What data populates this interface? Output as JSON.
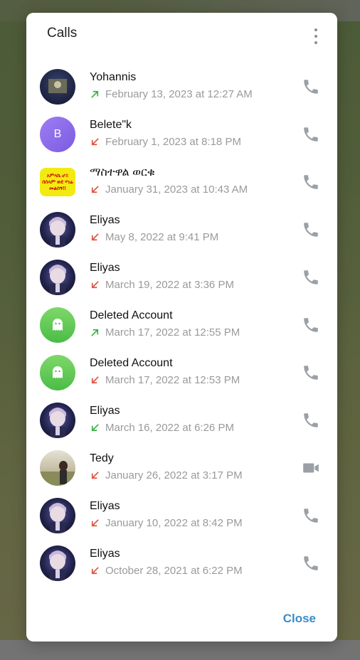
{
  "dialog": {
    "title": "Calls",
    "close_label": "Close"
  },
  "colors": {
    "outgoing": "#3cb043",
    "incoming_missed": "#e0533e",
    "incoming_ok": "#3cb043",
    "accent": "#3a8cc8"
  },
  "calls": [
    {
      "name": "Yohannis",
      "date": "February 13, 2023 at 12:27 AM",
      "direction": "outgoing",
      "type": "voice",
      "avatar": "photo-dark"
    },
    {
      "name": "Belete\"k",
      "date": "February 1, 2023 at 8:18 PM",
      "direction": "missed",
      "type": "voice",
      "avatar": "initial",
      "initial": "B"
    },
    {
      "name": "ማስተዋል ወርቁ",
      "date": "January 31, 2023 at 10:43 AM",
      "direction": "missed",
      "type": "voice",
      "avatar": "yellow-sign",
      "sign_text": "አምላኬ ሆይ በሰላም ወደ ሃገሬ መልሰኝ!!"
    },
    {
      "name": "Eliyas",
      "date": "May 8, 2022 at 9:41 PM",
      "direction": "missed",
      "type": "voice",
      "avatar": "anime"
    },
    {
      "name": "Eliyas",
      "date": "March 19, 2022 at 3:36 PM",
      "direction": "missed",
      "type": "voice",
      "avatar": "anime"
    },
    {
      "name": "Deleted Account",
      "date": "March 17, 2022 at 12:55 PM",
      "direction": "outgoing",
      "type": "voice",
      "avatar": "ghost"
    },
    {
      "name": "Deleted Account",
      "date": "March 17, 2022 at 12:53 PM",
      "direction": "missed",
      "type": "voice",
      "avatar": "ghost"
    },
    {
      "name": "Eliyas",
      "date": "March 16, 2022 at 6:26 PM",
      "direction": "incoming",
      "type": "voice",
      "avatar": "anime"
    },
    {
      "name": "Tedy",
      "date": "January 26, 2022 at 3:17 PM",
      "direction": "missed",
      "type": "video",
      "avatar": "photo-light"
    },
    {
      "name": "Eliyas",
      "date": "January 10, 2022 at 8:42 PM",
      "direction": "missed",
      "type": "voice",
      "avatar": "anime"
    },
    {
      "name": "Eliyas",
      "date": "October 28, 2021 at 6:22 PM",
      "direction": "missed",
      "type": "voice",
      "avatar": "anime"
    }
  ]
}
